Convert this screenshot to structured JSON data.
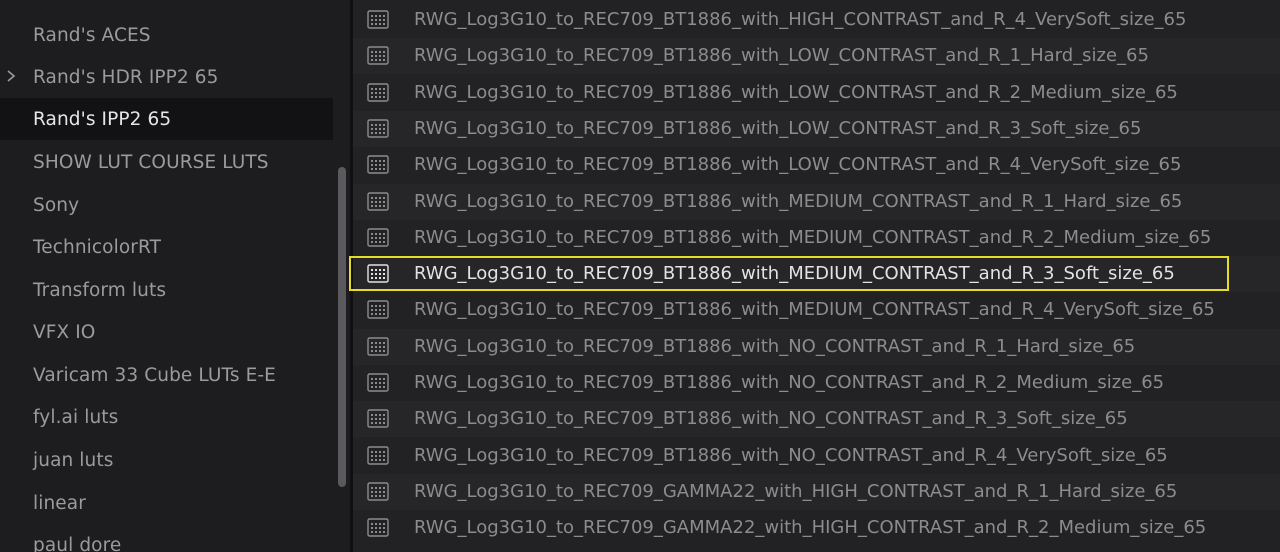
{
  "sidebar": {
    "folders": [
      {
        "label": "Rand's ACES",
        "expandable": false,
        "selected": false
      },
      {
        "label": "Rand's HDR IPP2 65",
        "expandable": true,
        "selected": false
      },
      {
        "label": "Rand's IPP2 65",
        "expandable": false,
        "selected": true
      },
      {
        "label": "SHOW LUT COURSE LUTS",
        "expandable": false,
        "selected": false
      },
      {
        "label": "Sony",
        "expandable": false,
        "selected": false
      },
      {
        "label": "TechnicolorRT",
        "expandable": false,
        "selected": false
      },
      {
        "label": "Transform luts",
        "expandable": false,
        "selected": false
      },
      {
        "label": "VFX IO",
        "expandable": false,
        "selected": false
      },
      {
        "label": "Varicam 33 Cube LUTs E-E",
        "expandable": false,
        "selected": false
      },
      {
        "label": "fyl.ai luts",
        "expandable": false,
        "selected": false
      },
      {
        "label": "juan luts",
        "expandable": false,
        "selected": false
      },
      {
        "label": "linear",
        "expandable": false,
        "selected": false
      },
      {
        "label": "paul dore",
        "expandable": false,
        "selected": false
      }
    ]
  },
  "luts": {
    "items": [
      {
        "label": "RWG_Log3G10_to_REC709_BT1886_with_HIGH_CONTRAST_and_R_4_VerySoft_size_65"
      },
      {
        "label": "RWG_Log3G10_to_REC709_BT1886_with_LOW_CONTRAST_and_R_1_Hard_size_65"
      },
      {
        "label": "RWG_Log3G10_to_REC709_BT1886_with_LOW_CONTRAST_and_R_2_Medium_size_65"
      },
      {
        "label": "RWG_Log3G10_to_REC709_BT1886_with_LOW_CONTRAST_and_R_3_Soft_size_65"
      },
      {
        "label": "RWG_Log3G10_to_REC709_BT1886_with_LOW_CONTRAST_and_R_4_VerySoft_size_65"
      },
      {
        "label": "RWG_Log3G10_to_REC709_BT1886_with_MEDIUM_CONTRAST_and_R_1_Hard_size_65"
      },
      {
        "label": "RWG_Log3G10_to_REC709_BT1886_with_MEDIUM_CONTRAST_and_R_2_Medium_size_65"
      },
      {
        "label": "RWG_Log3G10_to_REC709_BT1886_with_MEDIUM_CONTRAST_and_R_3_Soft_size_65"
      },
      {
        "label": "RWG_Log3G10_to_REC709_BT1886_with_MEDIUM_CONTRAST_and_R_4_VerySoft_size_65"
      },
      {
        "label": "RWG_Log3G10_to_REC709_BT1886_with_NO_CONTRAST_and_R_1_Hard_size_65"
      },
      {
        "label": "RWG_Log3G10_to_REC709_BT1886_with_NO_CONTRAST_and_R_2_Medium_size_65"
      },
      {
        "label": "RWG_Log3G10_to_REC709_BT1886_with_NO_CONTRAST_and_R_3_Soft_size_65"
      },
      {
        "label": "RWG_Log3G10_to_REC709_BT1886_with_NO_CONTRAST_and_R_4_VerySoft_size_65"
      },
      {
        "label": "RWG_Log3G10_to_REC709_GAMMA22_with_HIGH_CONTRAST_and_R_1_Hard_size_65"
      },
      {
        "label": "RWG_Log3G10_to_REC709_GAMMA22_with_HIGH_CONTRAST_and_R_2_Medium_size_65"
      }
    ],
    "highlighted_index": 7,
    "item_icon": "lut-grid-icon"
  },
  "colors": {
    "highlight_border": "#e3dc2a",
    "selected_folder_bg": "#121214"
  }
}
